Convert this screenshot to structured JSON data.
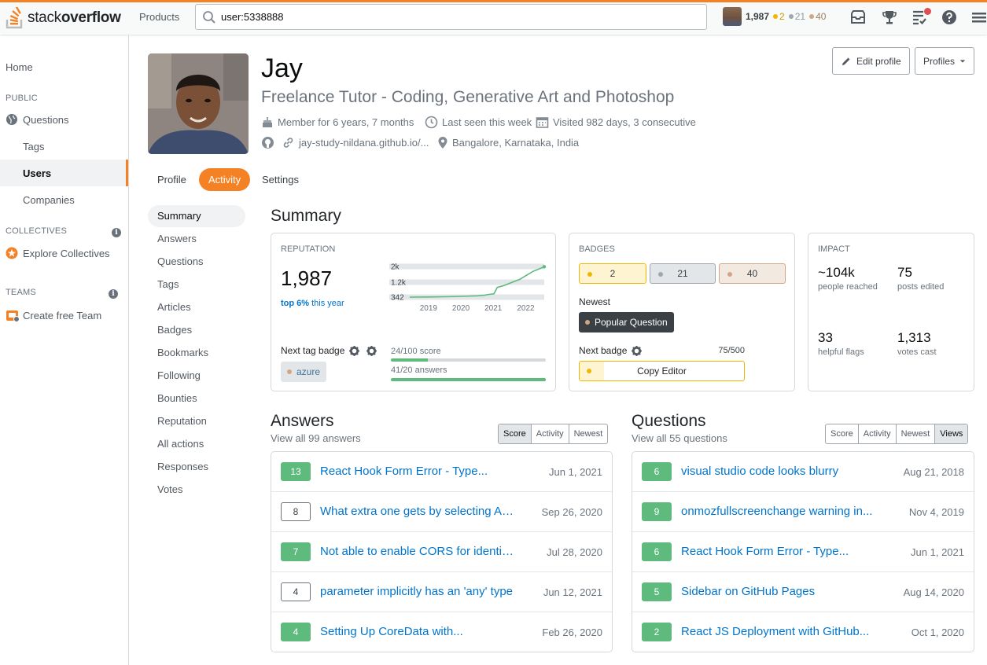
{
  "topbar": {
    "logo_plain": "stack",
    "logo_bold": "overflow",
    "products": "Products",
    "search_value": "user:5338888",
    "reputation": "1,987",
    "gold": "2",
    "silver": "21",
    "bronze": "40"
  },
  "leftnav": {
    "home": "Home",
    "public_head": "PUBLIC",
    "questions": "Questions",
    "tags": "Tags",
    "users": "Users",
    "companies": "Companies",
    "collectives_head": "COLLECTIVES",
    "explore_collectives": "Explore Collectives",
    "teams_head": "TEAMS",
    "create_team": "Create free Team",
    "info_glyph": "i"
  },
  "profile": {
    "name": "Jay",
    "title": "Freelance Tutor - Coding, Generative Art and Photoshop",
    "member_for": "Member for 6 years, 7 months",
    "last_seen": "Last seen this week",
    "visited": "Visited 982 days, 3 consecutive",
    "website": "jay-study-nildana.github.io/...",
    "location": "Bangalore, Karnataka, India",
    "edit_profile": "Edit profile",
    "profiles": "Profiles"
  },
  "tabs": [
    "Profile",
    "Activity",
    "Settings"
  ],
  "subnav": [
    "Summary",
    "Answers",
    "Questions",
    "Tags",
    "Articles",
    "Badges",
    "Bookmarks",
    "Following",
    "Bounties",
    "Reputation",
    "All actions",
    "Responses",
    "Votes"
  ],
  "summary": {
    "heading": "Summary",
    "reputation": {
      "label": "REPUTATION",
      "value": "1,987",
      "top_bold": "top 6%",
      "top_rest": " this year",
      "next_tag_badge": "Next tag badge",
      "tag": "azure",
      "score_progress": "24/100 score",
      "answers_progress": "41/20 answers"
    },
    "badges": {
      "label": "BADGES",
      "gold": "2",
      "silver": "21",
      "bronze": "40",
      "newest_label": "Newest",
      "newest_badge": "Popular Question",
      "next_badge_label": "Next badge",
      "next_badge_progress": "75/500",
      "next_badge_name": "Copy Editor"
    },
    "impact": {
      "label": "IMPACT",
      "people_reached": "~104k",
      "people_reached_label": "people reached",
      "posts_edited": "75",
      "posts_edited_label": "posts edited",
      "helpful_flags": "33",
      "helpful_flags_label": "helpful flags",
      "votes_cast": "1,313",
      "votes_cast_label": "votes cast"
    }
  },
  "chart_data": {
    "type": "line",
    "title": "",
    "x_ticks": [
      "2019",
      "2020",
      "2021",
      "2022"
    ],
    "y_ticks": [
      "342",
      "1.2k",
      "2k"
    ],
    "series": [
      {
        "x": [
          2018.4,
          2019.0,
          2019.5,
          2020.0,
          2020.5,
          2020.7,
          2020.85,
          2021.0,
          2021.1,
          2021.3,
          2021.5,
          2021.8,
          2022.0,
          2022.2,
          2022.4,
          2022.55
        ],
        "values": [
          342,
          350,
          365,
          385,
          420,
          450,
          500,
          530,
          900,
          1000,
          1150,
          1350,
          1550,
          1750,
          1880,
          1987
        ]
      }
    ],
    "xlim": [
      2018.4,
      2022.55
    ],
    "ylim": [
      300,
      2050
    ]
  },
  "answers": {
    "heading": "Answers",
    "subtitle": "View all 99 answers",
    "sorts": [
      "Score",
      "Activity",
      "Newest"
    ],
    "active_sort": 0,
    "rows": [
      {
        "score": "13",
        "accepted": true,
        "title": "React Hook Form Error - Type...",
        "date": "Jun 1, 2021"
      },
      {
        "score": "8",
        "accepted": false,
        "title": "What extra one gets by selecting Azur...",
        "date": "Sep 26, 2020"
      },
      {
        "score": "7",
        "accepted": true,
        "title": "Not able to enable CORS for identity...",
        "date": "Jul 28, 2020"
      },
      {
        "score": "4",
        "accepted": false,
        "title": "parameter implicitly has an 'any' type",
        "date": "Jun 12, 2021"
      },
      {
        "score": "4",
        "accepted": true,
        "title": "Setting Up CoreData with...",
        "date": "Feb 26, 2020"
      }
    ]
  },
  "questions": {
    "heading": "Questions",
    "subtitle": "View all 55 questions",
    "sorts": [
      "Score",
      "Activity",
      "Newest",
      "Views"
    ],
    "active_sort": 3,
    "rows": [
      {
        "score": "6",
        "accepted": true,
        "title": "visual studio code looks blurry",
        "date": "Aug 21, 2018"
      },
      {
        "score": "9",
        "accepted": true,
        "title": "onmozfullscreenchange warning in...",
        "date": "Nov 4, 2019"
      },
      {
        "score": "6",
        "accepted": true,
        "title": "React Hook Form Error - Type...",
        "date": "Jun 1, 2021"
      },
      {
        "score": "5",
        "accepted": true,
        "title": "Sidebar on GitHub Pages",
        "date": "Aug 14, 2020"
      },
      {
        "score": "2",
        "accepted": true,
        "title": "React JS Deployment with GitHub...",
        "date": "Oct 1, 2020"
      }
    ]
  },
  "colors": {
    "accent": "#f48225",
    "link": "#0074cc",
    "accepted": "#5eba7d",
    "gold": "#f1b600",
    "silver": "#9fa6ad",
    "bronze": "#d1a684"
  }
}
